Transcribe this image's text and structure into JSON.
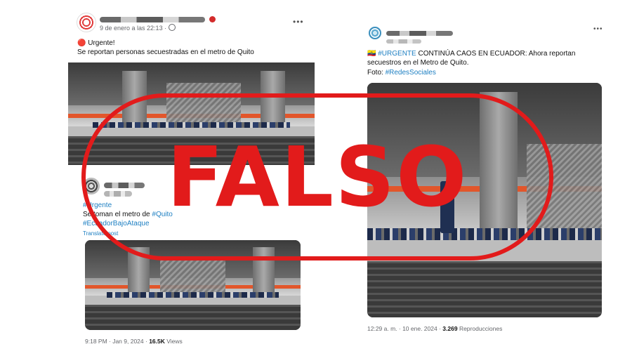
{
  "left_post": {
    "timestamp": "9 de enero a las 22:13 ·",
    "alert_emoji": "🔴",
    "title": "Urgente!",
    "body": "Se reportan personas secuestradas en el metro de Quito",
    "more_icon": "more-horizontal-icon",
    "globe_icon": "globe-icon"
  },
  "embedded_tweet": {
    "hashtag1": "#Urgente",
    "line2_prefix": "Se toman el metro de ",
    "line2_link": "#Quito",
    "hashtag2": "#EcuadorBajoAtaque",
    "translate": "Translate post",
    "time_date": "9:18 PM · Jan 9, 2024 ·",
    "views_count": "16.5K",
    "views_label": "Views"
  },
  "right_post": {
    "flag_emoji": "🇪🇨",
    "hashtag": "#URGENTE",
    "text1": " CONTINÚA  CAOS EN ECUADOR: Ahora reportan",
    "text2": "secuestros en el Metro de Quito.",
    "foto_prefix": "Foto: ",
    "foto_link": "#RedesSociales",
    "time_date": "12:29 a. m. · 10 ene. 2024 ·",
    "views_count": "3.269",
    "views_label": "Reproducciones",
    "more_icon": "more-horizontal-icon"
  },
  "stamp": {
    "label": "FALSO",
    "color": "#e21b1b"
  },
  "colors": {
    "link": "#1d7fc2",
    "accent_stripe": "#e2562b"
  }
}
